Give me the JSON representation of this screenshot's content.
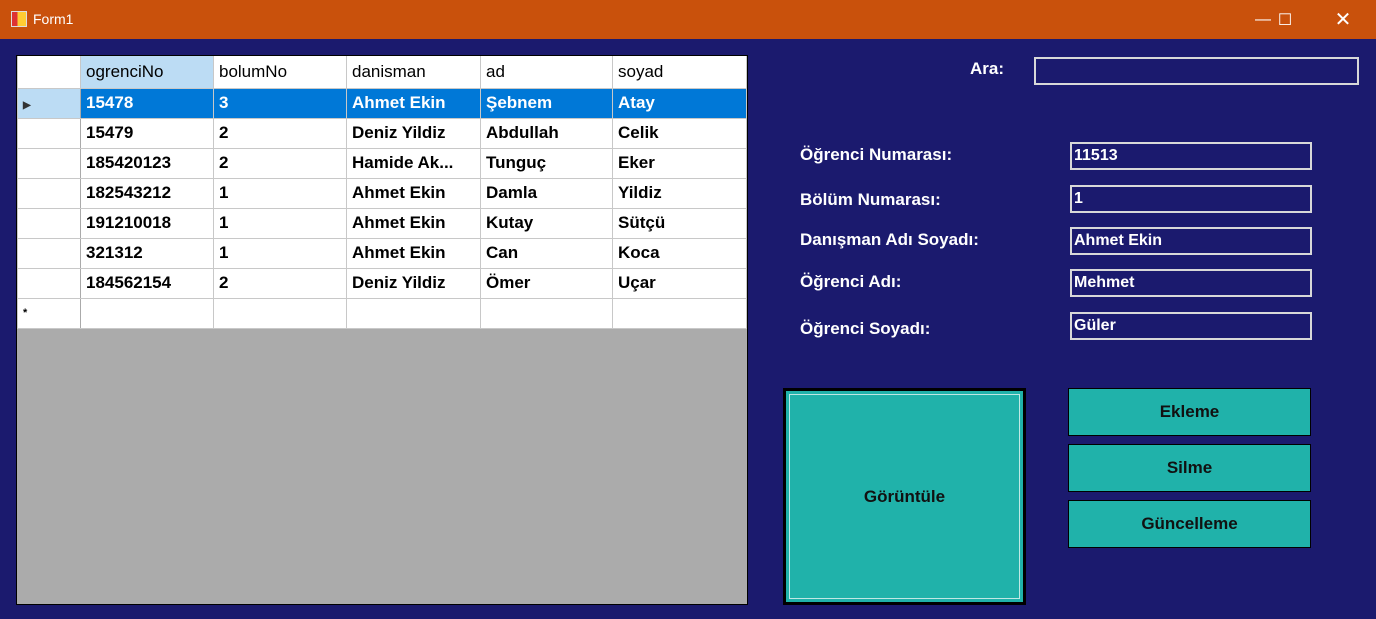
{
  "window": {
    "title": "Form1",
    "icon": "winforms-app-icon"
  },
  "grid": {
    "columns": [
      "ogrenciNo",
      "bolumNo",
      "danisman",
      "ad",
      "soyad"
    ],
    "rows": [
      [
        "15478",
        "3",
        "Ahmet Ekin",
        "Şebnem",
        "Atay"
      ],
      [
        "15479",
        "2",
        "Deniz Yildiz",
        "Abdullah",
        "Celik"
      ],
      [
        "185420123",
        "2",
        "Hamide Ak...",
        "Tunguç",
        "Eker"
      ],
      [
        "182543212",
        "1",
        "Ahmet Ekin",
        "Damla",
        "Yildiz"
      ],
      [
        "191210018",
        "1",
        "Ahmet Ekin",
        "Kutay",
        "Sütçü"
      ],
      [
        "321312",
        "1",
        "Ahmet Ekin",
        "Can",
        "Koca"
      ],
      [
        "184562154",
        "2",
        "Deniz Yildiz",
        "Ömer",
        "Uçar"
      ]
    ],
    "selected_row": 0,
    "current_row_marker": "▶",
    "new_row_marker": "*"
  },
  "search": {
    "label": "Ara:",
    "value": ""
  },
  "form": {
    "ogrenci_no": {
      "label": "Öğrenci Numarası:",
      "value": "11513"
    },
    "bolum_no": {
      "label": "Bölüm Numarası:",
      "value": "1"
    },
    "danisman": {
      "label": "Danışman Adı Soyadı:",
      "value": "Ahmet Ekin"
    },
    "ad": {
      "label": "Öğrenci Adı:",
      "value": "Mehmet"
    },
    "soyad": {
      "label": "Öğrenci Soyadı:",
      "value": "Güler"
    }
  },
  "buttons": {
    "goruntule": "Görüntüle",
    "ekleme": "Ekleme",
    "silme": "Silme",
    "guncelleme": "Güncelleme"
  },
  "colors": {
    "titlebar": "#c9510c",
    "background": "#1b1a6e",
    "button": "#20b2aa",
    "selection": "#0078d7"
  }
}
